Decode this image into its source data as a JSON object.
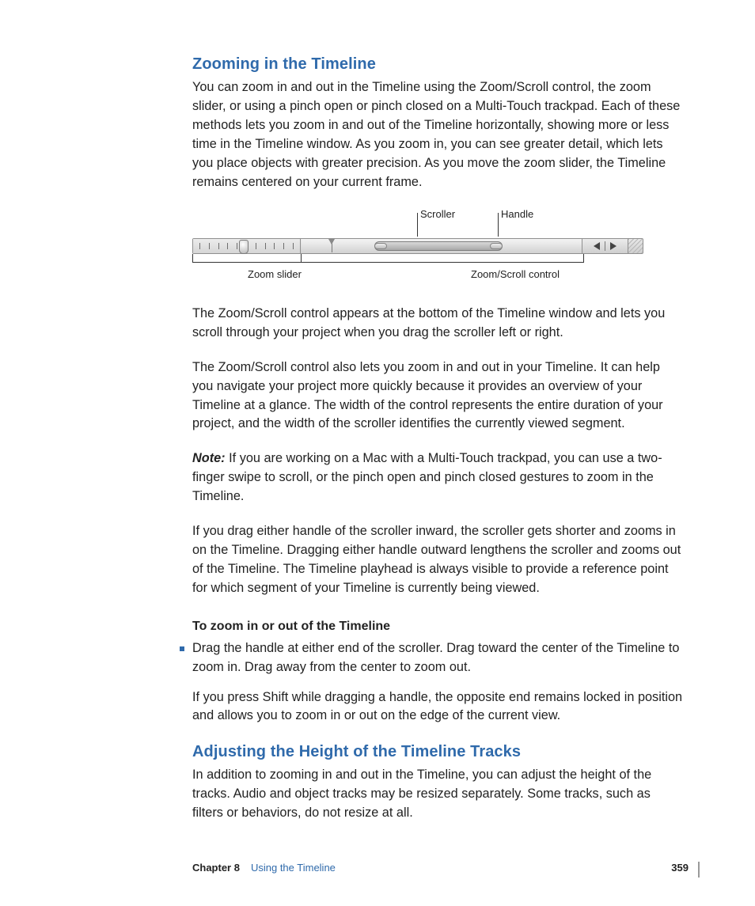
{
  "section1": {
    "heading": "Zooming in the Timeline",
    "p1": "You can zoom in and out in the Timeline using the Zoom/Scroll control, the zoom slider, or using a pinch open or pinch closed on a Multi-Touch trackpad. Each of these methods lets you zoom in and out of the Timeline horizontally, showing more or less time in the Timeline window. As you zoom in, you can see greater detail, which lets you place objects with greater precision. As you move the zoom slider, the Timeline remains centered on your current frame."
  },
  "figure": {
    "labels": {
      "scroller": "Scroller",
      "handle": "Handle",
      "zoom_slider": "Zoom slider",
      "zoom_scroll_control": "Zoom/Scroll control"
    }
  },
  "body": {
    "p2": "The Zoom/Scroll control appears at the bottom of the Timeline window and lets you scroll through your project when you drag the scroller left or right.",
    "p3": "The Zoom/Scroll control also lets you zoom in and out in your Timeline. It can help you navigate your project more quickly because it provides an overview of your Timeline at a glance. The width of the control represents the entire duration of your project, and the width of the scroller identifies the currently viewed segment.",
    "note_label": "Note:",
    "note_text": "  If you are working on a Mac with a Multi-Touch trackpad, you can use a two-finger swipe to scroll, or the pinch open and pinch closed gestures to zoom in the Timeline.",
    "p4": "If you drag either handle of the scroller inward, the scroller gets shorter and zooms in on the Timeline. Dragging either handle outward lengthens the scroller and zooms out of the Timeline. The Timeline playhead is always visible to provide a reference point for which segment of your Timeline is currently being viewed."
  },
  "task": {
    "title": "To zoom in or out of the Timeline",
    "step_a": "Drag the handle at either end of the scroller. Drag toward the center of the Timeline to zoom in. Drag away from the center to zoom out.",
    "step_b": "If you press Shift while dragging a handle, the opposite end remains locked in position and allows you to zoom in or out on the edge of the current view."
  },
  "section2": {
    "heading": "Adjusting the Height of the Timeline Tracks",
    "p1": "In addition to zooming in and out in the Timeline, you can adjust the height of the tracks. Audio and object tracks may be resized separately. Some tracks, such as filters or behaviors, do not resize at all."
  },
  "footer": {
    "chapter": "Chapter 8",
    "title": "Using the Timeline",
    "page": "359"
  }
}
